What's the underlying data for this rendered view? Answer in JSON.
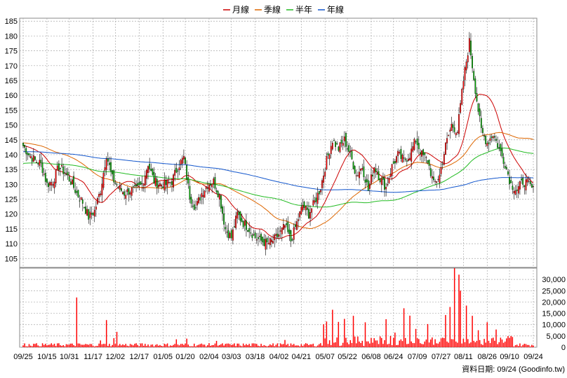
{
  "chart_data": {
    "type": "candlestick",
    "legend": {
      "placement": "top-center",
      "items": [
        {
          "label": "月線",
          "color": "#cc0000"
        },
        {
          "label": "季線",
          "color": "#dd6600"
        },
        {
          "label": "半年",
          "color": "#22bb22"
        },
        {
          "label": "年線",
          "color": "#1155cc"
        }
      ]
    },
    "price_axis": {
      "ylim": [
        102,
        186
      ],
      "ticks": [
        105,
        110,
        115,
        120,
        125,
        130,
        135,
        140,
        145,
        150,
        155,
        160,
        165,
        170,
        175,
        180,
        185
      ],
      "position": "left",
      "grid": true
    },
    "volume_axis": {
      "ylim": [
        0,
        35000
      ],
      "ticks": [
        "0",
        "5,000",
        "10,000",
        "15,000",
        "20,000",
        "25,000",
        "30,000"
      ],
      "tick_values": [
        0,
        5000,
        10000,
        15000,
        20000,
        25000,
        30000
      ],
      "position": "right"
    },
    "x_ticks": [
      "09/25",
      "10/15",
      "10/31",
      "11/17",
      "12/02",
      "12/17",
      "01/05",
      "01/20",
      "02/04",
      "03/03",
      "03/18",
      "04/02",
      "04/21",
      "05/07",
      "05/22",
      "06/08",
      "06/24",
      "07/09",
      "07/27",
      "08/11",
      "08/26",
      "09/10",
      "09/24"
    ],
    "footer": "資料日期: 09/24  (Goodinfo.tw)",
    "colors": {
      "up": "#ff0000",
      "down": "#00aa00",
      "volume": "#ff0000",
      "grid": "#aaaaaa"
    },
    "price_anchors": [
      [
        0,
        143
      ],
      [
        4,
        140
      ],
      [
        8,
        138
      ],
      [
        12,
        137
      ],
      [
        16,
        130
      ],
      [
        20,
        131
      ],
      [
        24,
        136
      ],
      [
        28,
        134
      ],
      [
        32,
        131
      ],
      [
        36,
        127
      ],
      [
        40,
        124
      ],
      [
        44,
        119
      ],
      [
        48,
        121
      ],
      [
        52,
        128
      ],
      [
        56,
        140
      ],
      [
        60,
        132
      ],
      [
        64,
        129
      ],
      [
        68,
        127
      ],
      [
        72,
        128
      ],
      [
        76,
        128
      ],
      [
        80,
        130
      ],
      [
        84,
        137
      ],
      [
        88,
        131
      ],
      [
        92,
        130
      ],
      [
        96,
        130
      ],
      [
        100,
        131
      ],
      [
        104,
        136
      ],
      [
        108,
        139
      ],
      [
        112,
        126
      ],
      [
        116,
        122
      ],
      [
        120,
        127
      ],
      [
        124,
        130
      ],
      [
        128,
        131
      ],
      [
        132,
        126
      ],
      [
        136,
        115
      ],
      [
        140,
        112
      ],
      [
        144,
        120
      ],
      [
        148,
        117
      ],
      [
        152,
        115
      ],
      [
        156,
        112
      ],
      [
        160,
        111
      ],
      [
        164,
        110
      ],
      [
        168,
        111
      ],
      [
        172,
        113
      ],
      [
        176,
        116
      ],
      [
        180,
        111
      ],
      [
        184,
        117
      ],
      [
        188,
        123
      ],
      [
        192,
        120
      ],
      [
        196,
        124
      ],
      [
        200,
        129
      ],
      [
        204,
        138
      ],
      [
        208,
        145
      ],
      [
        212,
        142
      ],
      [
        216,
        145
      ],
      [
        220,
        140
      ],
      [
        224,
        133
      ],
      [
        228,
        136
      ],
      [
        232,
        128
      ],
      [
        236,
        136
      ],
      [
        240,
        132
      ],
      [
        244,
        129
      ],
      [
        248,
        136
      ],
      [
        252,
        140
      ],
      [
        256,
        138
      ],
      [
        260,
        140
      ],
      [
        264,
        145
      ],
      [
        268,
        140
      ],
      [
        272,
        138
      ],
      [
        276,
        130
      ],
      [
        280,
        133
      ],
      [
        284,
        143
      ],
      [
        288,
        150
      ],
      [
        292,
        148
      ],
      [
        296,
        165
      ],
      [
        300,
        178
      ],
      [
        304,
        162
      ],
      [
        308,
        148
      ],
      [
        312,
        144
      ],
      [
        316,
        147
      ],
      [
        320,
        142
      ],
      [
        324,
        137
      ],
      [
        328,
        130
      ],
      [
        332,
        128
      ],
      [
        336,
        131
      ],
      [
        340,
        130
      ],
      [
        343,
        128
      ]
    ],
    "volume_spikes": [
      [
        7,
        1500
      ],
      [
        36,
        22000
      ],
      [
        52,
        3000
      ],
      [
        56,
        12000
      ],
      [
        61,
        4000
      ],
      [
        63,
        6800
      ],
      [
        75,
        1500
      ],
      [
        103,
        3500
      ],
      [
        110,
        3800
      ],
      [
        130,
        2800
      ],
      [
        160,
        1500
      ],
      [
        176,
        3200
      ],
      [
        202,
        7500
      ],
      [
        204,
        10000
      ],
      [
        208,
        16000
      ],
      [
        212,
        9000
      ],
      [
        216,
        12000
      ],
      [
        222,
        11500
      ],
      [
        230,
        9500
      ],
      [
        244,
        11000
      ],
      [
        250,
        3500
      ],
      [
        256,
        17000
      ],
      [
        260,
        11500
      ],
      [
        264,
        8000
      ],
      [
        272,
        9500
      ],
      [
        284,
        13000
      ],
      [
        287,
        15000
      ],
      [
        290,
        34000
      ],
      [
        293,
        30000
      ],
      [
        294,
        25000
      ],
      [
        298,
        18000
      ],
      [
        302,
        11000
      ],
      [
        306,
        7000
      ],
      [
        312,
        8000
      ],
      [
        318,
        5000
      ],
      [
        326,
        3000
      ]
    ]
  }
}
